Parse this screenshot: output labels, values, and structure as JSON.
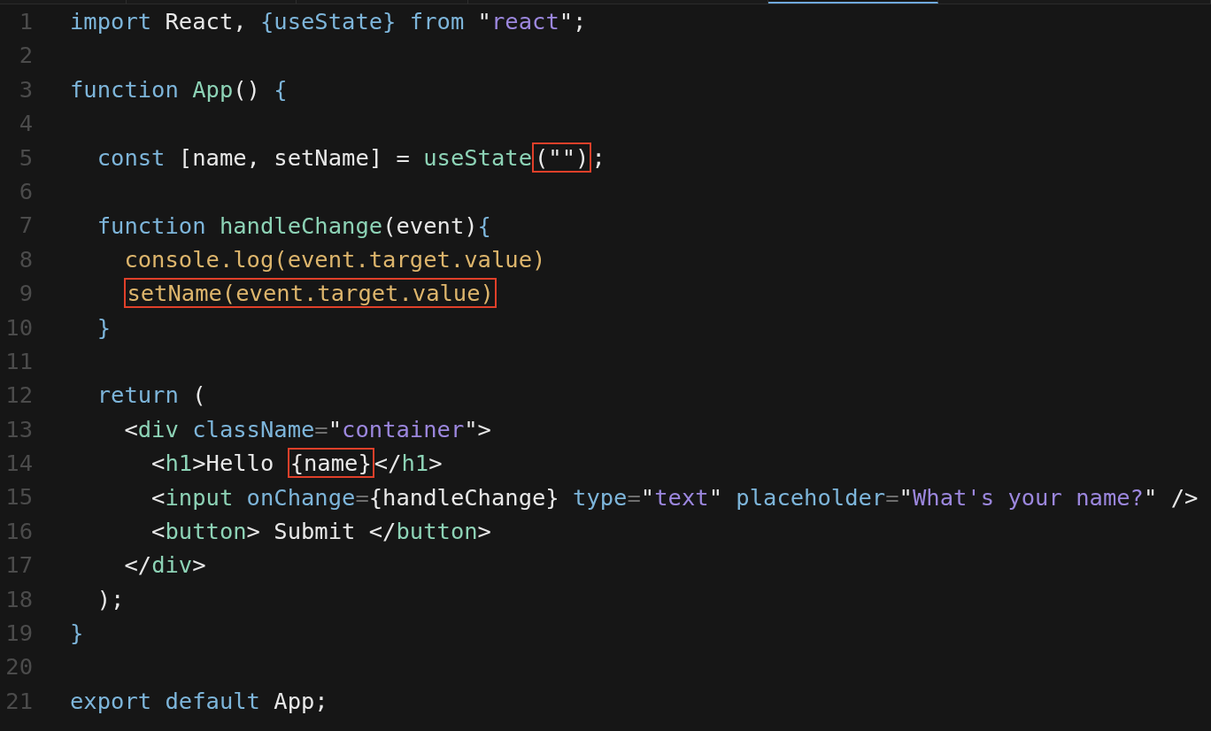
{
  "tabs": [
    {
      "selected": false
    },
    {
      "selected": false
    },
    {
      "selected": false
    },
    {
      "selected": false
    },
    {
      "selected": true
    },
    {
      "selected": false
    }
  ],
  "lines": [
    {
      "number": "1",
      "tokens": [
        {
          "text": "import",
          "kind": "kw"
        },
        {
          "text": " React, ",
          "kind": "pl"
        },
        {
          "text": "{useState}",
          "kind": "kw"
        },
        {
          "text": " from",
          "kind": "kw"
        },
        {
          "text": " \"",
          "kind": "pl"
        },
        {
          "text": "react",
          "kind": "str"
        },
        {
          "text": "\";",
          "kind": "pl"
        }
      ]
    },
    {
      "number": "2"
    },
    {
      "number": "3",
      "tokens": [
        {
          "text": "function ",
          "kind": "kw"
        },
        {
          "text": "App",
          "kind": "fn"
        },
        {
          "text": "() ",
          "kind": "pl"
        },
        {
          "text": "{",
          "kind": "kw"
        }
      ]
    },
    {
      "number": "4"
    },
    {
      "number": "5",
      "tokens": [
        {
          "text": "  const",
          "kind": "kw"
        },
        {
          "text": " [name, setName] = ",
          "kind": "pl"
        },
        {
          "text": "useState",
          "kind": "fn"
        },
        {
          "kind": "box",
          "tokens": [
            {
              "text": "(\"\")",
              "kind": "pl"
            }
          ]
        },
        {
          "text": ";",
          "kind": "pl"
        }
      ]
    },
    {
      "number": "6"
    },
    {
      "number": "7",
      "tokens": [
        {
          "text": "  function ",
          "kind": "kw"
        },
        {
          "text": "handleChange",
          "kind": "fn"
        },
        {
          "text": "(event)",
          "kind": "pl"
        },
        {
          "text": "{",
          "kind": "kw"
        }
      ]
    },
    {
      "number": "8",
      "tokens": [
        {
          "text": "    console.log(event.target.value)",
          "kind": "gold"
        }
      ]
    },
    {
      "number": "9",
      "tokens": [
        {
          "kind": "box",
          "tokens": [
            {
              "text": "setName(event.target.value)",
              "kind": "gold"
            }
          ]
        }
      ]
    },
    {
      "number": "10",
      "tokens": [
        {
          "text": "  }",
          "kind": "kw"
        }
      ]
    },
    {
      "number": "11"
    },
    {
      "number": "12",
      "tokens": [
        {
          "text": "  return",
          "kind": "kw"
        },
        {
          "text": " (",
          "kind": "pl"
        }
      ]
    },
    {
      "number": "13",
      "tokens": [
        {
          "text": "    <",
          "kind": "pl"
        },
        {
          "text": "div",
          "kind": "fn"
        },
        {
          "text": " className",
          "kind": "kw"
        },
        {
          "text": "=",
          "kind": "op"
        },
        {
          "text": "\"",
          "kind": "pl"
        },
        {
          "text": "container",
          "kind": "str"
        },
        {
          "text": "\">",
          "kind": "pl"
        }
      ]
    },
    {
      "number": "14",
      "tokens": [
        {
          "text": "      <",
          "kind": "pl"
        },
        {
          "text": "h1",
          "kind": "fn"
        },
        {
          "text": ">Hello ",
          "kind": "pl"
        },
        {
          "kind": "box",
          "tokens": [
            {
              "text": "{name}",
              "kind": "pl"
            }
          ]
        },
        {
          "text": "</",
          "kind": "pl"
        },
        {
          "text": "h1",
          "kind": "fn"
        },
        {
          "text": ">",
          "kind": "pl"
        }
      ]
    },
    {
      "number": "15",
      "tokens": [
        {
          "text": "      <",
          "kind": "pl"
        },
        {
          "text": "input",
          "kind": "fn"
        },
        {
          "text": " onChange",
          "kind": "kw"
        },
        {
          "text": "=",
          "kind": "op"
        },
        {
          "text": "{handleChange} ",
          "kind": "pl"
        },
        {
          "text": "type",
          "kind": "kw"
        },
        {
          "text": "=",
          "kind": "op"
        },
        {
          "text": "\"",
          "kind": "pl"
        },
        {
          "text": "text",
          "kind": "str"
        },
        {
          "text": "\" ",
          "kind": "pl"
        },
        {
          "text": "placeholder",
          "kind": "kw"
        },
        {
          "text": "=",
          "kind": "op"
        },
        {
          "text": "\"",
          "kind": "pl"
        },
        {
          "text": "What's your name?",
          "kind": "str"
        },
        {
          "text": "\" />",
          "kind": "pl"
        }
      ]
    },
    {
      "number": "16",
      "tokens": [
        {
          "text": "      <",
          "kind": "pl"
        },
        {
          "text": "button",
          "kind": "fn"
        },
        {
          "text": "> Submit </",
          "kind": "pl"
        },
        {
          "text": "button",
          "kind": "fn"
        },
        {
          "text": ">",
          "kind": "pl"
        }
      ]
    },
    {
      "number": "17",
      "tokens": [
        {
          "text": "    </",
          "kind": "pl"
        },
        {
          "text": "div",
          "kind": "fn"
        },
        {
          "text": ">",
          "kind": "pl"
        }
      ]
    },
    {
      "number": "18",
      "tokens": [
        {
          "text": "  );",
          "kind": "pl"
        }
      ]
    },
    {
      "number": "19",
      "tokens": [
        {
          "text": "}",
          "kind": "kw"
        }
      ]
    },
    {
      "number": "20"
    },
    {
      "number": "21",
      "tokens": [
        {
          "text": "export default",
          "kind": "kw"
        },
        {
          "text": " App;",
          "kind": "pl"
        }
      ]
    }
  ]
}
